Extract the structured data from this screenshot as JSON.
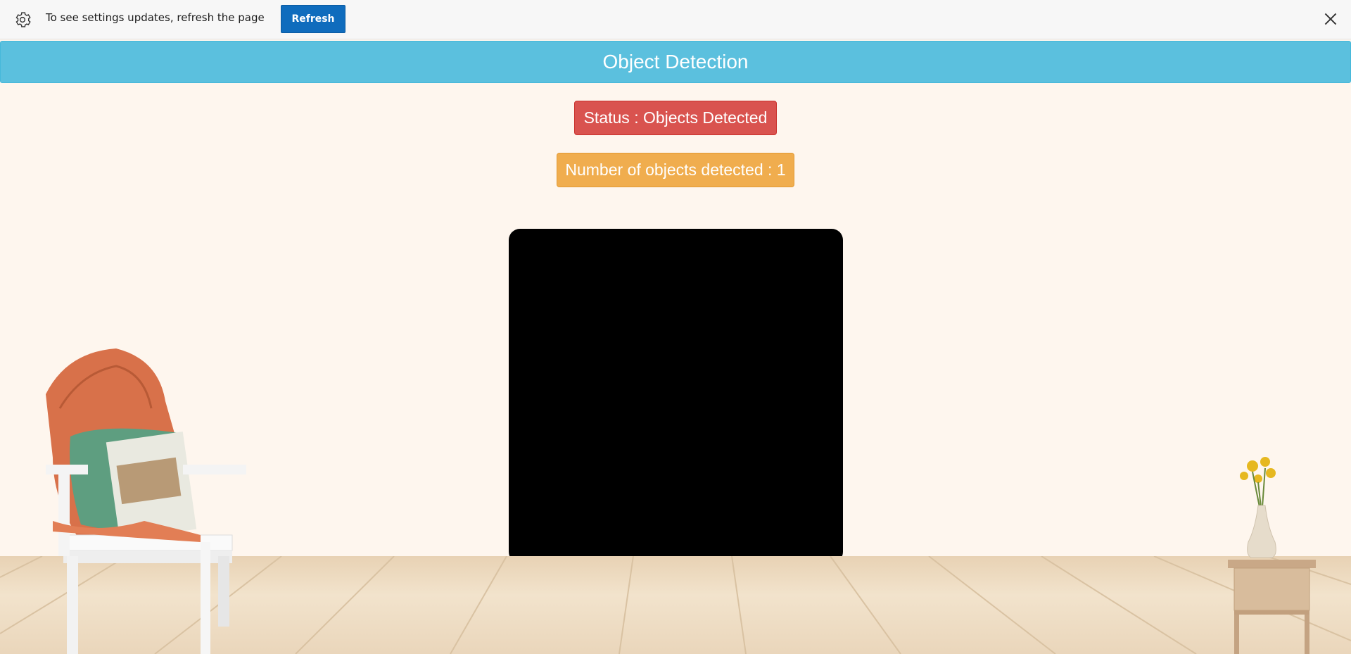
{
  "notification": {
    "message": "To see settings updates, refresh the page",
    "refresh_label": "Refresh",
    "icon": "gear-icon",
    "close_icon": "close-icon"
  },
  "header": {
    "title": "Object Detection"
  },
  "status": {
    "label": "Status : Objects Detected",
    "color": "#d9534f"
  },
  "detection_count": {
    "label": "Number of objects detected : 1",
    "color": "#f0ad4e"
  },
  "colors": {
    "header_bg": "#5bc0de",
    "page_bg": "#fef6ee",
    "refresh_button": "#0f6cbd",
    "video_bg": "#000000"
  }
}
